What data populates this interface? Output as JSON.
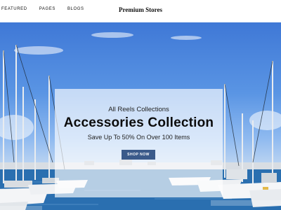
{
  "header": {
    "nav": [
      "FEATURED",
      "PAGES",
      "BLOGS"
    ],
    "logo": "Premium Stores"
  },
  "hero": {
    "kicker": "All Reels Collections",
    "headline": "Accessories Collection",
    "subtext": "Save Up To 50% On Over 100 Items",
    "button_label": "SHOP NOW",
    "image": "marina-sailboats-image"
  },
  "colors": {
    "button_bg": "#3a5a8a",
    "sky": "#4a85dc",
    "water": "#2a6fb0"
  }
}
